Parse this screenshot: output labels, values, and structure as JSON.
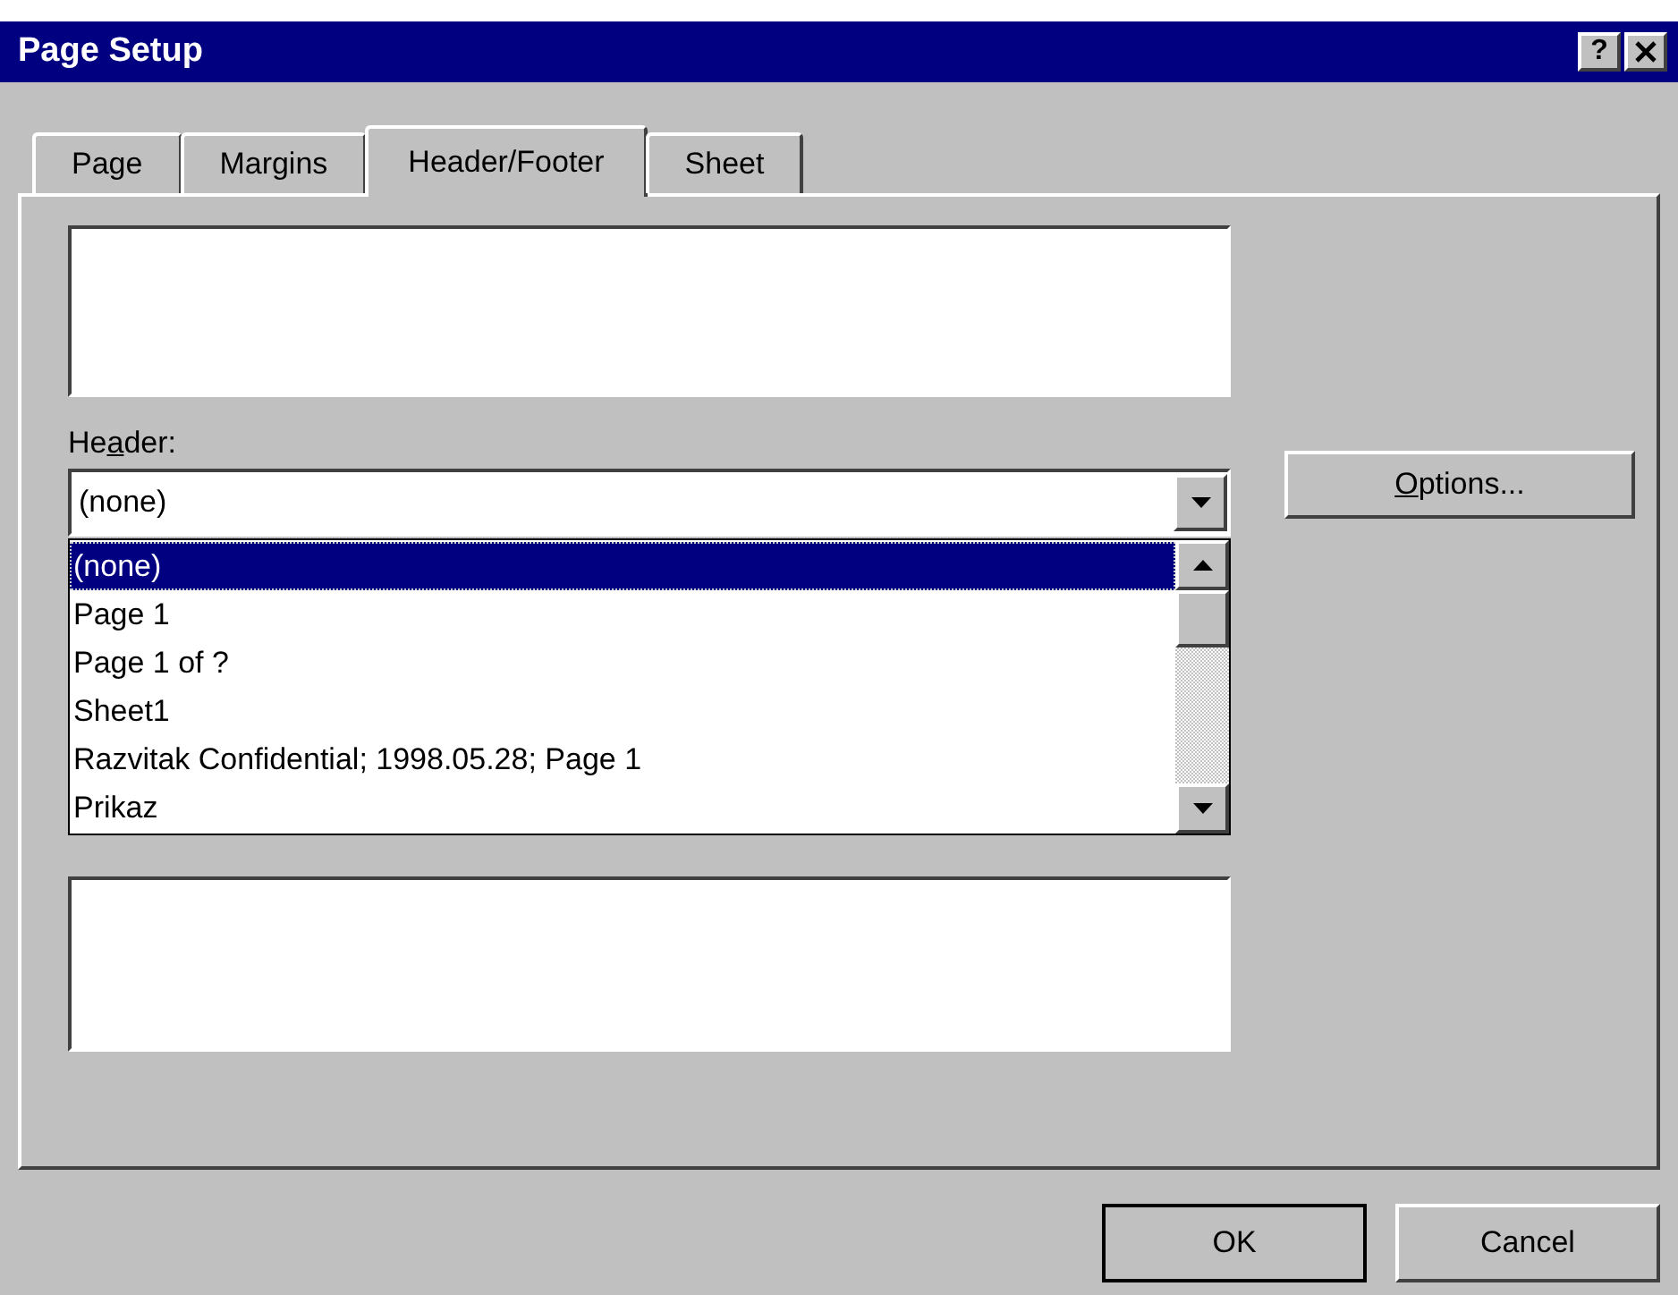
{
  "window": {
    "title": "Page Setup",
    "help": "?"
  },
  "tabs": [
    {
      "label": "Page",
      "selected": false
    },
    {
      "label": "Margins",
      "selected": false
    },
    {
      "label": "Header/Footer",
      "selected": true
    },
    {
      "label": "Sheet",
      "selected": false
    }
  ],
  "header": {
    "label": {
      "before": "He",
      "key": "a",
      "after": "der:"
    },
    "value": "(none)",
    "expanded": true,
    "options": [
      {
        "label": "(none)",
        "selected": true
      },
      {
        "label": "Page 1",
        "selected": false
      },
      {
        "label": "Page 1 of ?",
        "selected": false
      },
      {
        "label": "Sheet1",
        "selected": false
      },
      {
        "label": "Razvitak Confidential; 1998.05.28; Page 1",
        "selected": false
      },
      {
        "label": "Prikaz",
        "selected": false
      }
    ]
  },
  "options_button": {
    "label": {
      "key": "O",
      "after": "ptions..."
    }
  },
  "buttons": [
    {
      "label": "OK",
      "default": true
    },
    {
      "label": "Cancel",
      "default": false
    }
  ]
}
